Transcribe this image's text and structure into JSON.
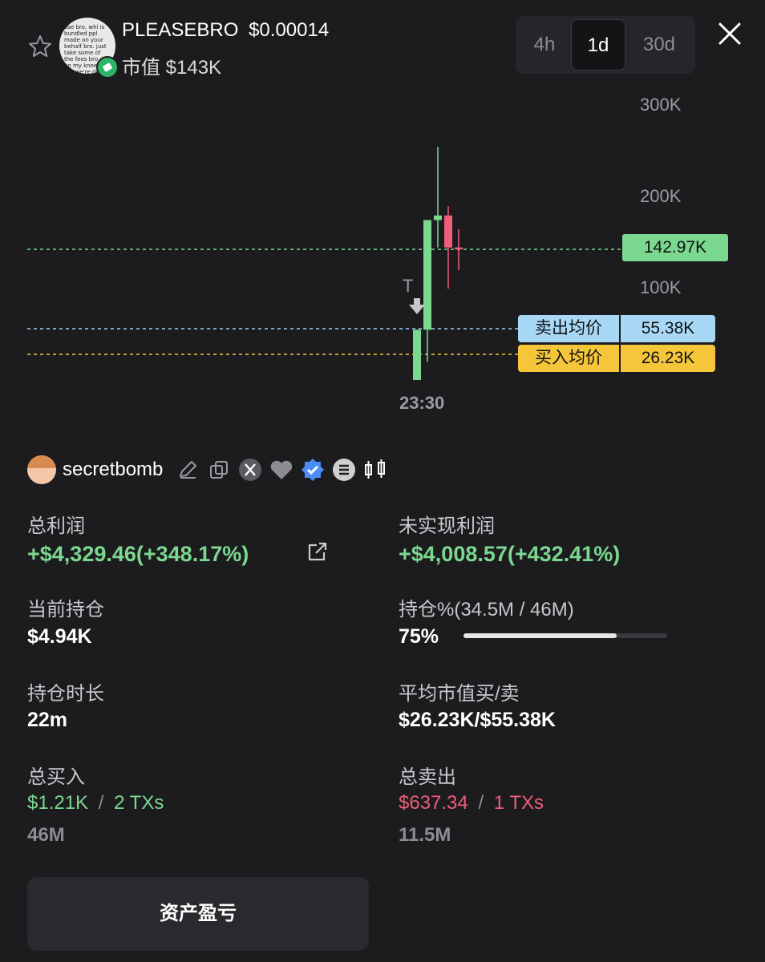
{
  "header": {
    "token_name": "PLEASEBRO",
    "token_price": "$0.00014",
    "market_cap": "市值 $143K",
    "avatar_text": "ase bro, whi is bundled ppl made on your behalf bro. just take some of the fees bro, i'm on my knees bro we're doing this support you s ase bro."
  },
  "timeframes": [
    {
      "label": "4h",
      "active": false
    },
    {
      "label": "1d",
      "active": true
    },
    {
      "label": "30d",
      "active": false
    }
  ],
  "chart": {
    "y_ticks": [
      "300K",
      "200K",
      "100K"
    ],
    "x_tick": "23:30",
    "marker_label": "T",
    "current_value_tag": "142.97K",
    "sell_avg": {
      "label": "卖出均价",
      "value": "55.38K"
    },
    "buy_avg": {
      "label": "买入均价",
      "value": "26.23K"
    },
    "colors": {
      "up": "#7bd88f",
      "down": "#ef5d78",
      "sell_line": "#9fd2f5",
      "buy_line": "#f5c63a"
    }
  },
  "chart_data": {
    "type": "candlestick",
    "x_label": "23:30",
    "ylim": [
      0,
      320000
    ],
    "candles": [
      {
        "open": 0,
        "close": 55000,
        "high": 55000,
        "low": 0
      },
      {
        "open": 55000,
        "close": 175000,
        "high": 175000,
        "low": 20000
      },
      {
        "open": 175000,
        "close": 180000,
        "high": 255000,
        "low": 145000
      },
      {
        "open": 180000,
        "close": 145000,
        "high": 190000,
        "low": 100000
      },
      {
        "open": 145000,
        "close": 142970,
        "high": 165000,
        "low": 120000
      }
    ],
    "reference_lines": [
      {
        "name": "卖出均价",
        "value": 55380
      },
      {
        "name": "买入均价",
        "value": 26230
      },
      {
        "name": "current",
        "value": 142970
      }
    ]
  },
  "user": {
    "name": "secretbomb"
  },
  "stats": {
    "total_profit": {
      "label": "总利润",
      "value": "+$4,329.46(+348.17%)"
    },
    "unrealized_profit": {
      "label": "未实现利润",
      "value": "+$4,008.57(+432.41%)"
    },
    "current_position": {
      "label": "当前持仓",
      "value": "$4.94K"
    },
    "position_pct": {
      "label": "持仓%(34.5M / 46M)",
      "value": "75%",
      "fill": 0.75
    },
    "hold_duration": {
      "label": "持仓时长",
      "value": "22m"
    },
    "avg_mc": {
      "label": "平均市值买/卖",
      "value": "$26.23K/$55.38K"
    },
    "total_buy": {
      "label": "总买入",
      "amount": "$1.21K",
      "sep": "/",
      "txs": "2 TXs",
      "tokens": "46M"
    },
    "total_sell": {
      "label": "总卖出",
      "amount": "$637.34",
      "sep": "/",
      "txs": "1 TXs",
      "tokens": "11.5M"
    }
  },
  "button": {
    "label": "资产盈亏"
  }
}
